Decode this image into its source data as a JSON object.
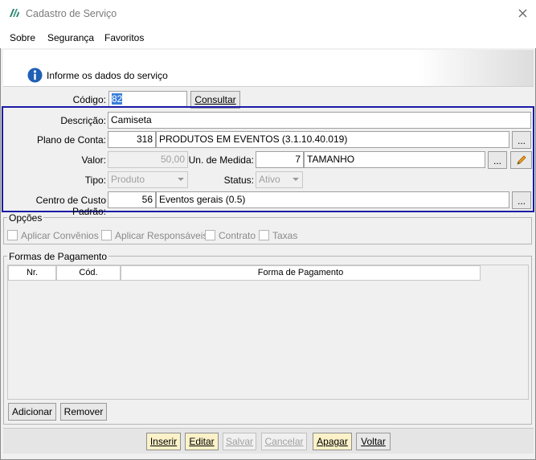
{
  "window": {
    "title": "Cadastro de Serviço"
  },
  "menu": {
    "sobre": "Sobre",
    "seguranca": "Segurança",
    "favoritos": "Favoritos"
  },
  "banner": {
    "text": "Informe os dados do serviço"
  },
  "form": {
    "codigo_label": "Código:",
    "codigo_value": "82",
    "consultar_label": "Consultar",
    "descricao_label": "Descrição:",
    "descricao_value": "Camiseta",
    "plano_label": "Plano de Conta:",
    "plano_code": "318",
    "plano_desc": "PRODUTOS EM EVENTOS (3.1.10.40.019)",
    "valor_label": "Valor:",
    "valor_value": "50,00",
    "unidade_label": "Un. de Medida:",
    "unidade_code": "7",
    "unidade_desc": "TAMANHO",
    "tipo_label": "Tipo:",
    "tipo_value": "Produto",
    "status_label": "Status:",
    "status_value": "Ativo",
    "centro_label": "Centro de Custo Padrão:",
    "centro_code": "56",
    "centro_desc": "Eventos gerais (0.5)",
    "ellipsis": "..."
  },
  "opcoes": {
    "title": "Opções",
    "items": [
      "Aplicar Convênios",
      "Aplicar Responsáveis",
      "Contrato",
      "Taxas"
    ]
  },
  "pagamento": {
    "title": "Formas de Pagamento",
    "columns": [
      "Nr.",
      "Cód.",
      "Forma de Pagamento"
    ],
    "adicionar": "Adicionar",
    "remover": "Remover"
  },
  "actions": {
    "inserir": "Inserir",
    "editar": "Editar",
    "salvar": "Salvar",
    "cancelar": "Cancelar",
    "apagar": "Apagar",
    "voltar": "Voltar"
  },
  "colors": {
    "highlight_border": "#1a1aa8",
    "button_highlight": "#fcf2c9"
  }
}
